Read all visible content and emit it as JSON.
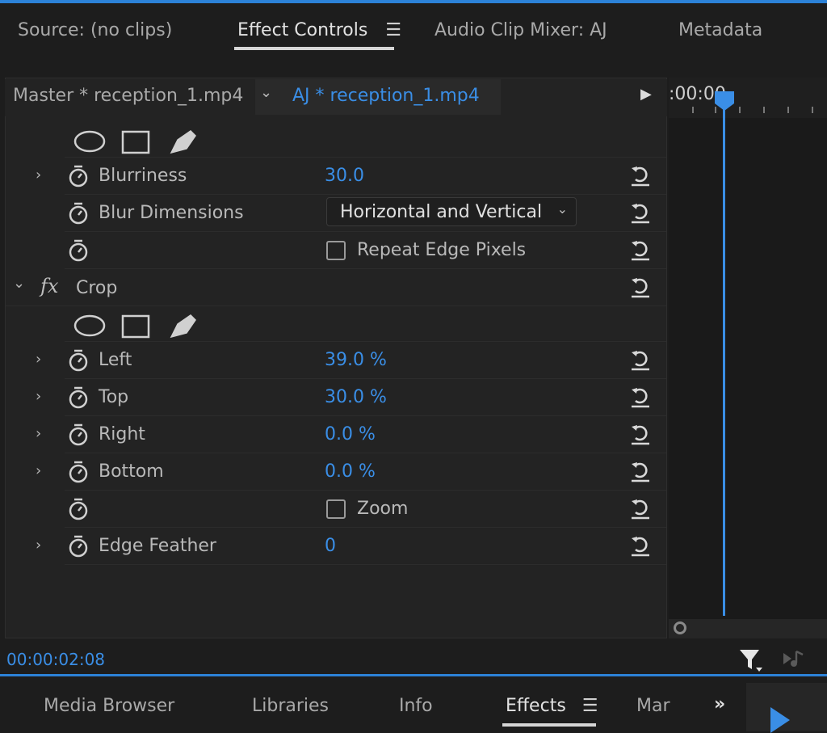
{
  "top_tabs": [
    {
      "label": "Source: (no clips)"
    },
    {
      "label": "Effect Controls"
    },
    {
      "label": "Audio Clip Mixer: AJ"
    },
    {
      "label": "Metadata"
    }
  ],
  "header": {
    "master_label": "Master * reception_1.mp4",
    "clip_label": "AJ * reception_1.mp4"
  },
  "ruler": {
    "time": ":00:00"
  },
  "blur": {
    "blurriness": {
      "label": "Blurriness",
      "value": "30.0"
    },
    "dimensions": {
      "label": "Blur Dimensions",
      "value": "Horizontal and Vertical"
    },
    "repeat_edge": {
      "label": "Repeat Edge Pixels",
      "checked": false
    }
  },
  "crop": {
    "label": "Crop",
    "fx_label": "fx",
    "left": {
      "label": "Left",
      "value": "39.0 %"
    },
    "top": {
      "label": "Top",
      "value": "30.0 %"
    },
    "right": {
      "label": "Right",
      "value": "0.0 %"
    },
    "bottom": {
      "label": "Bottom",
      "value": "0.0 %"
    },
    "zoom": {
      "label": "Zoom",
      "checked": false
    },
    "edge_feather": {
      "label": "Edge Feather",
      "value": "0"
    }
  },
  "status": {
    "timecode": "00:00:02:08"
  },
  "bottom_tabs": [
    {
      "label": "Media Browser"
    },
    {
      "label": "Libraries"
    },
    {
      "label": "Info"
    },
    {
      "label": "Effects"
    },
    {
      "label": "Mar"
    }
  ],
  "colors": {
    "accent": "#3a8ee6",
    "background": "#1d1d1d"
  }
}
